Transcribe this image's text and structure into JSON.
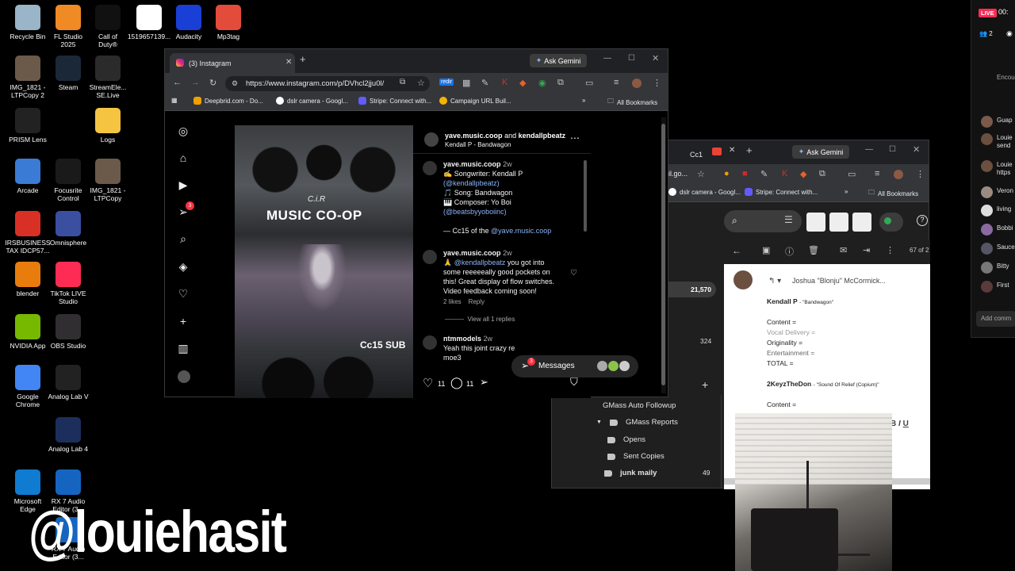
{
  "desktop": {
    "icons": [
      {
        "label": "Recycle Bin",
        "name": "recycle-bin-icon",
        "color": "#9ab4c8"
      },
      {
        "label": "FL Studio\n2025",
        "name": "fl-studio-icon",
        "color": "#f08a24"
      },
      {
        "label": "Call of\nDuty®",
        "name": "call-of-duty-icon",
        "color": "#111111"
      },
      {
        "label": "1519657139...",
        "name": "video-file-icon",
        "color": "#ffffff"
      },
      {
        "label": "Audacity",
        "name": "audacity-icon",
        "color": "#1a3fd6"
      },
      {
        "label": "Mp3tag",
        "name": "mp3tag-icon",
        "color": "#e34b3b"
      },
      {
        "label": "IMG_1821 -\nLTPCopy 2",
        "name": "image-file-icon",
        "color": "#6b5a4a"
      },
      {
        "label": "Steam",
        "name": "steam-icon",
        "color": "#1b2838"
      },
      {
        "label": "StreamEle...\nSE.Live",
        "name": "streamelements-icon",
        "color": "#2b2b2b"
      },
      {
        "label": "PRISM Lens",
        "name": "prism-lens-icon",
        "color": "#222222"
      },
      {
        "label": "Logs",
        "name": "folder-icon",
        "color": "#f5c542"
      },
      {
        "label": "Arcade",
        "name": "arcade-icon",
        "color": "#3a7bd5"
      },
      {
        "label": "Focusrite\nControl",
        "name": "focusrite-icon",
        "color": "#1a1a1a"
      },
      {
        "label": "IMG_1821 -\nLTPCopy",
        "name": "image-file-icon-2",
        "color": "#6b5a4a"
      },
      {
        "label": "IRSBUSINESS\nTAX IDCP57...",
        "name": "pdf-file-icon",
        "color": "#d93025"
      },
      {
        "label": "Omnisphere",
        "name": "omnisphere-icon",
        "color": "#3b4fa0"
      },
      {
        "label": "blender",
        "name": "blender-icon",
        "color": "#e87d0d"
      },
      {
        "label": "TikTok LIVE\nStudio",
        "name": "tiktok-live-icon",
        "color": "#fe2c55"
      },
      {
        "label": "NVIDIA App",
        "name": "nvidia-icon",
        "color": "#76b900"
      },
      {
        "label": "OBS Studio",
        "name": "obs-icon",
        "color": "#302e31"
      },
      {
        "label": "Google\nChrome",
        "name": "chrome-icon",
        "color": "#4285f4"
      },
      {
        "label": "Analog Lab V",
        "name": "analog-lab-v-icon",
        "color": "#222222"
      },
      {
        "label": "Analog Lab 4",
        "name": "analog-lab-4-icon",
        "color": "#1c2f5c"
      },
      {
        "label": "Microsoft\nEdge",
        "name": "edge-icon",
        "color": "#0f7bd1"
      },
      {
        "label": "RX 7 Audio\nEditor (3...",
        "name": "rx7-icon",
        "color": "#1565c0"
      },
      {
        "label": "RX 7 Audio\nEditor (3...",
        "name": "rx7-icon-2",
        "color": "#1565c0"
      }
    ],
    "watermark": "@louiehasit"
  },
  "browser1": {
    "tab_title": "(3) Instagram",
    "ask_gemini": "Ask Gemini",
    "url": "https://www.instagram.com/p/DVhcl2jju0l/",
    "bookmarks": [
      "Deepbrid.com - Do...",
      "dslr camera - Googl...",
      "Stripe: Connect with...",
      "Campaign URL Buil..."
    ],
    "all_bookmarks": "All Bookmarks",
    "post": {
      "image_text": "MUSIC CO-OP",
      "image_logo": "C.i.R",
      "image_badge": "Cc15 SUB",
      "header_user": "yave.music.coop",
      "header_and": "and",
      "header_user2": "kendallpbeatz",
      "header_sub": "Kendall P - Bandwagon",
      "caption_user": "yave.music.coop",
      "caption_time": "2w",
      "caption_lines": [
        "✍️ Songwriter: Kendall P",
        "(@kendallpbeatz)",
        "🎵 Song: Bandwagon",
        "🎹 Composer: Yo Boi",
        "(@beatsbyyoboiinc)"
      ],
      "caption_sign": "— Cc15 of the",
      "caption_sign_link": "@yave.music.coop",
      "comment1_user": "yave.music.coop",
      "comment1_time": "2w",
      "comment1_mention": "@kendallpbeatz",
      "comment1_text": "you got into some reeeeeally good pockets on this! Great display of flow switches. Video feedback coming soon!",
      "comment1_likes": "2 likes",
      "comment1_reply": "Reply",
      "view_replies": "View all 1 replies",
      "comment2_user": "ntmmodels",
      "comment2_time": "2w",
      "comment2_text": "Yeah this joint crazy re",
      "comment2_text2": "moe3",
      "likes_count": "11",
      "comments_count": "11",
      "messages_label": "Messages",
      "messages_badge": "3",
      "notif_badge": "3"
    }
  },
  "browser2": {
    "tab1": "Cc1",
    "ask_gemini": "Ask Gemini",
    "url_fragment": "il.go...",
    "bookmarks": [
      "dslr camera - Googl...",
      "Stripe: Connect with..."
    ],
    "all_bookmarks": "All Bookmarks",
    "count_21570": "21,570",
    "count_324": "324",
    "page_count": "67 of 2",
    "sender": "Joshua \"Blonju\" McCormick...",
    "email_lines": {
      "l1_bold": "Kendall P",
      "l1_small": "- \"Bandwagon\"",
      "content": "Content =",
      "vocal": "Vocal Delivery =",
      "originality": "Originality =",
      "entertainment": "Entertainment =",
      "total": "TOTAL =",
      "l2_bold": "2KeyzTheDon",
      "l2_small": "- \"Sound Of Relief (Copium)\"",
      "content2": "Content ="
    },
    "labels": [
      {
        "text": "GMass Auto Followup",
        "bold": false
      },
      {
        "text": "GMass Reports",
        "bold": false
      },
      {
        "text": "Opens",
        "bold": false
      },
      {
        "text": "Sent Copies",
        "bold": false
      },
      {
        "text": "junk maily",
        "bold": true,
        "count": "49"
      }
    ]
  },
  "right_panel": {
    "live": "LIVE",
    "timer": "00:",
    "viewers": "2",
    "encourage": "Encourag",
    "chat": [
      "Guap",
      "Louie\nsend",
      "Louie\nhttps",
      "Veron",
      "living",
      "Bobbi",
      "Sauce",
      "Bitty",
      "First"
    ],
    "add_comment": "Add comm"
  }
}
